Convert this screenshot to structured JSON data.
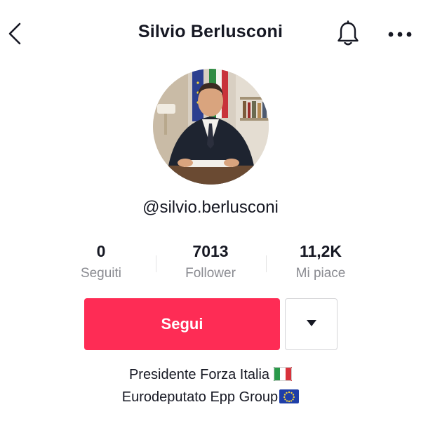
{
  "header": {
    "title": "Silvio Berlusconi",
    "back_icon": "chevron-left-icon",
    "bell_icon": "bell-icon",
    "more_icon": "more-horizontal-icon"
  },
  "profile": {
    "username": "@silvio.berlusconi"
  },
  "stats": [
    {
      "value": "0",
      "label": "Seguiti"
    },
    {
      "value": "7013",
      "label": "Follower"
    },
    {
      "value": "11,2K",
      "label": "Mi piace"
    }
  ],
  "actions": {
    "follow_label": "Segui",
    "dropdown_icon": "caret-down-icon"
  },
  "bio": {
    "line1": "Presidente Forza Italia",
    "line1_flag": "italy-flag-icon",
    "line2": "Eurodeputato Epp Group",
    "line2_flag": "eu-flag-icon"
  },
  "colors": {
    "accent": "#fe2c55",
    "text": "#161823",
    "secondary_text": "#8a8b91"
  }
}
